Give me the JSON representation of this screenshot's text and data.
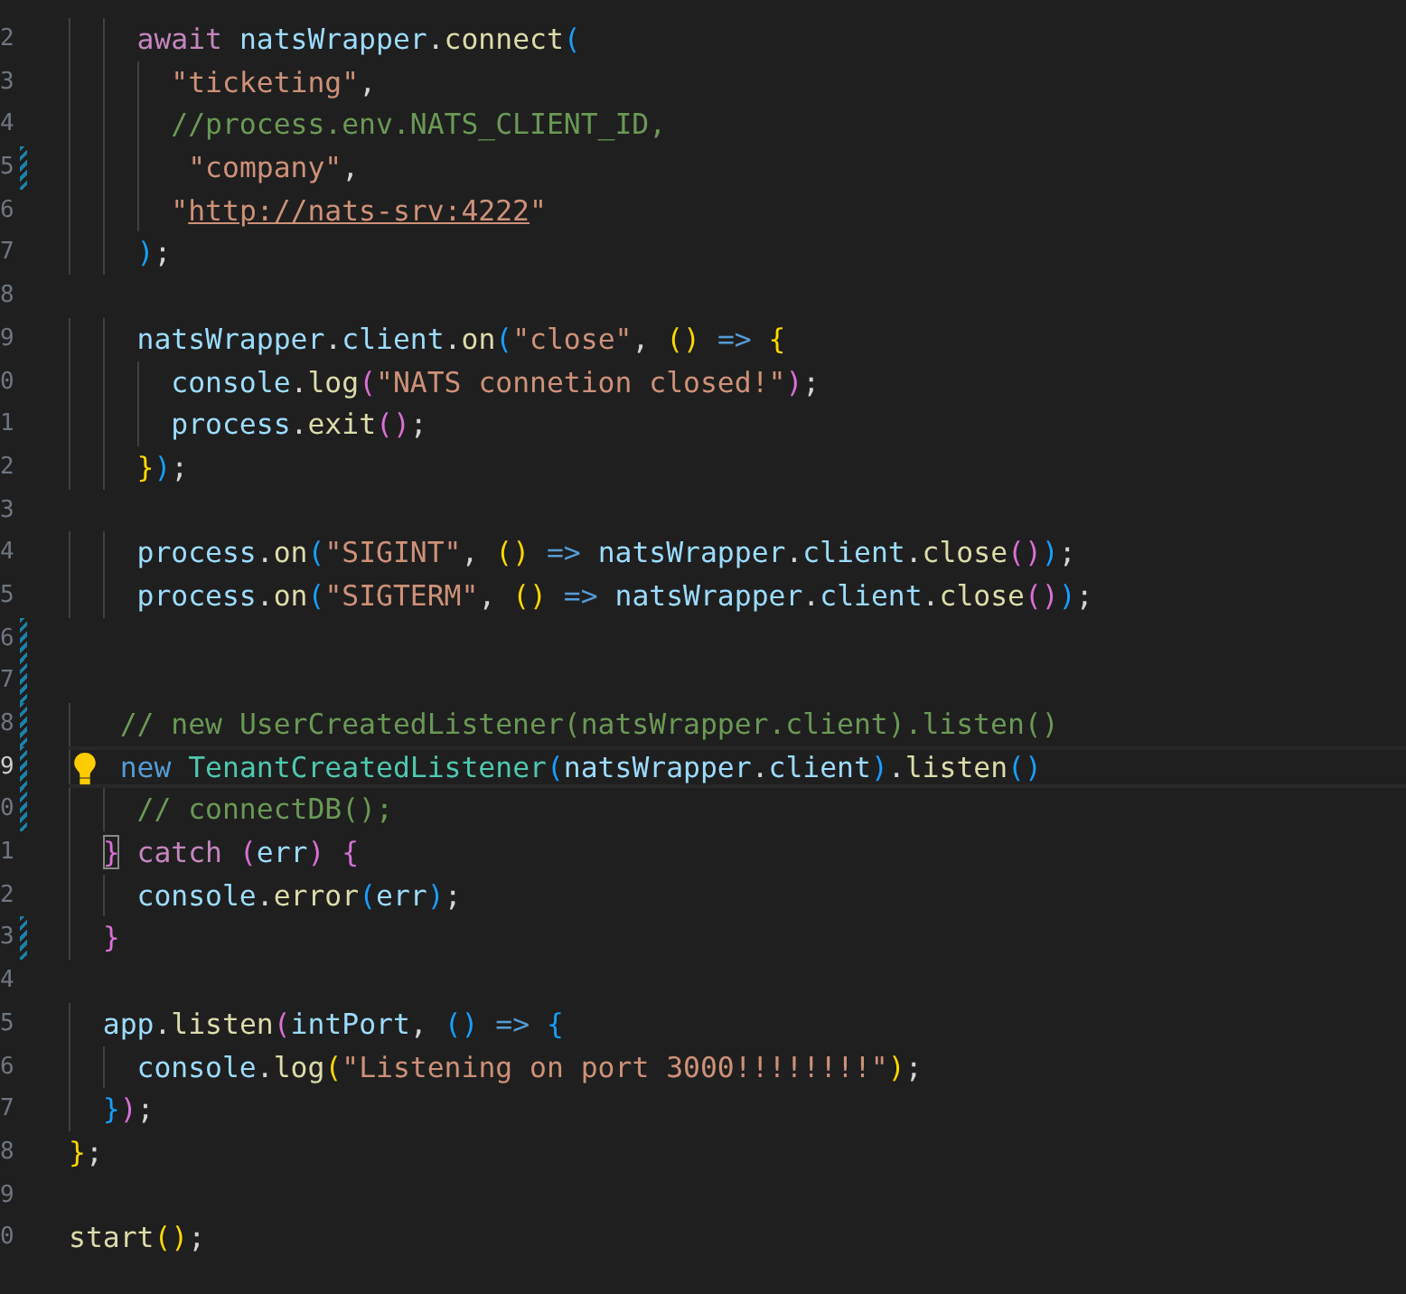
{
  "editor": {
    "lines": [
      {
        "number": "2",
        "tokens": [
          {
            "t": "    await",
            "kind": "keyword"
          },
          {
            "t": " natsWrapper",
            "kind": "variable"
          },
          {
            "t": ".",
            "kind": "plain"
          },
          {
            "t": "connect",
            "kind": "function"
          },
          {
            "t": "(",
            "kind": "bracket",
            "color": "#179fff"
          }
        ]
      },
      {
        "number": "3",
        "tokens": [
          {
            "t": "      \"ticketing\"",
            "kind": "string"
          },
          {
            "t": ",",
            "kind": "plain"
          }
        ]
      },
      {
        "number": "4",
        "tokens": [
          {
            "t": "      //process.env.NATS_CLIENT_ID,",
            "kind": "comment"
          }
        ]
      },
      {
        "number": "5",
        "modified": true,
        "tokens": [
          {
            "t": "       \"company\"",
            "kind": "string"
          },
          {
            "t": ",",
            "kind": "plain"
          }
        ]
      },
      {
        "number": "6",
        "tokens": [
          {
            "t": "      \"",
            "kind": "string"
          },
          {
            "t": "http://nats-srv:4222",
            "kind": "link"
          },
          {
            "t": "\"",
            "kind": "string"
          }
        ]
      },
      {
        "number": "7",
        "tokens": [
          {
            "t": "    )",
            "kind": "bracket",
            "color": "#179fff"
          },
          {
            "t": ";",
            "kind": "plain"
          }
        ]
      },
      {
        "number": "8"
      },
      {
        "number": "9",
        "tokens": [
          {
            "t": "    natsWrapper",
            "kind": "variable"
          },
          {
            "t": ".",
            "kind": "plain"
          },
          {
            "t": "client",
            "kind": "variable"
          },
          {
            "t": ".",
            "kind": "plain"
          },
          {
            "t": "on",
            "kind": "function"
          },
          {
            "t": "(",
            "kind": "bracket",
            "color": "#179fff"
          },
          {
            "t": "\"close\"",
            "kind": "string"
          },
          {
            "t": ", ",
            "kind": "plain"
          },
          {
            "t": "()",
            "kind": "bracket",
            "color": "#ffd700"
          },
          {
            "t": " => ",
            "kind": "storage"
          },
          {
            "t": "{",
            "kind": "bracket",
            "color": "#ffd700"
          }
        ]
      },
      {
        "number": "0",
        "tokens": [
          {
            "t": "      console",
            "kind": "variable"
          },
          {
            "t": ".",
            "kind": "plain"
          },
          {
            "t": "log",
            "kind": "function"
          },
          {
            "t": "(",
            "kind": "bracket",
            "color": "#da70d6"
          },
          {
            "t": "\"NATS connetion closed!\"",
            "kind": "string"
          },
          {
            "t": ")",
            "kind": "bracket",
            "color": "#da70d6"
          },
          {
            "t": ";",
            "kind": "plain"
          }
        ]
      },
      {
        "number": "1",
        "tokens": [
          {
            "t": "      process",
            "kind": "variable"
          },
          {
            "t": ".",
            "kind": "plain"
          },
          {
            "t": "exit",
            "kind": "function"
          },
          {
            "t": "()",
            "kind": "bracket",
            "color": "#da70d6"
          },
          {
            "t": ";",
            "kind": "plain"
          }
        ]
      },
      {
        "number": "2",
        "tokens": [
          {
            "t": "    }",
            "kind": "bracket",
            "color": "#ffd700"
          },
          {
            "t": ")",
            "kind": "bracket",
            "color": "#179fff"
          },
          {
            "t": ";",
            "kind": "plain"
          }
        ]
      },
      {
        "number": "3"
      },
      {
        "number": "4",
        "tokens": [
          {
            "t": "    process",
            "kind": "variable"
          },
          {
            "t": ".",
            "kind": "plain"
          },
          {
            "t": "on",
            "kind": "function"
          },
          {
            "t": "(",
            "kind": "bracket",
            "color": "#179fff"
          },
          {
            "t": "\"SIGINT\"",
            "kind": "string"
          },
          {
            "t": ", ",
            "kind": "plain"
          },
          {
            "t": "()",
            "kind": "bracket",
            "color": "#ffd700"
          },
          {
            "t": " => ",
            "kind": "storage"
          },
          {
            "t": "natsWrapper",
            "kind": "variable"
          },
          {
            "t": ".",
            "kind": "plain"
          },
          {
            "t": "client",
            "kind": "variable"
          },
          {
            "t": ".",
            "kind": "plain"
          },
          {
            "t": "close",
            "kind": "function"
          },
          {
            "t": "()",
            "kind": "bracket",
            "color": "#da70d6"
          },
          {
            "t": ")",
            "kind": "bracket",
            "color": "#179fff"
          },
          {
            "t": ";",
            "kind": "plain"
          }
        ]
      },
      {
        "number": "5",
        "tokens": [
          {
            "t": "    process",
            "kind": "variable"
          },
          {
            "t": ".",
            "kind": "plain"
          },
          {
            "t": "on",
            "kind": "function"
          },
          {
            "t": "(",
            "kind": "bracket",
            "color": "#179fff"
          },
          {
            "t": "\"SIGTERM\"",
            "kind": "string"
          },
          {
            "t": ", ",
            "kind": "plain"
          },
          {
            "t": "()",
            "kind": "bracket",
            "color": "#ffd700"
          },
          {
            "t": " => ",
            "kind": "storage"
          },
          {
            "t": "natsWrapper",
            "kind": "variable"
          },
          {
            "t": ".",
            "kind": "plain"
          },
          {
            "t": "client",
            "kind": "variable"
          },
          {
            "t": ".",
            "kind": "plain"
          },
          {
            "t": "close",
            "kind": "function"
          },
          {
            "t": "()",
            "kind": "bracket",
            "color": "#da70d6"
          },
          {
            "t": ")",
            "kind": "bracket",
            "color": "#179fff"
          },
          {
            "t": ";",
            "kind": "plain"
          }
        ]
      },
      {
        "number": "6",
        "modified": true
      },
      {
        "number": "7",
        "modified": true
      },
      {
        "number": "8",
        "modified": true,
        "tokens": [
          {
            "t": "   // new UserCreatedListener(natsWrapper.client).listen()",
            "kind": "comment"
          }
        ]
      },
      {
        "number": "9",
        "modified": true,
        "current": true,
        "lightbulb": true,
        "tokens": [
          {
            "t": "   new",
            "kind": "storage"
          },
          {
            "t": " TenantCreatedListener",
            "kind": "type"
          },
          {
            "t": "(",
            "kind": "bracket",
            "color": "#179fff"
          },
          {
            "t": "natsWrapper",
            "kind": "variable"
          },
          {
            "t": ".",
            "kind": "plain"
          },
          {
            "t": "client",
            "kind": "variable"
          },
          {
            "t": ")",
            "kind": "bracket",
            "color": "#179fff"
          },
          {
            "t": ".",
            "kind": "plain"
          },
          {
            "t": "listen",
            "kind": "function"
          },
          {
            "t": "()",
            "kind": "bracket",
            "color": "#179fff"
          }
        ]
      },
      {
        "number": "0",
        "modified": true,
        "tokens": [
          {
            "t": "    // connectDB();",
            "kind": "comment"
          }
        ]
      },
      {
        "number": "1",
        "tokens": [
          {
            "t": "  }",
            "kind": "bracket",
            "color": "#da70d6",
            "boxed": true
          },
          {
            "t": " catch",
            "kind": "keyword"
          },
          {
            "t": " (",
            "kind": "bracket",
            "color": "#da70d6"
          },
          {
            "t": "err",
            "kind": "variable"
          },
          {
            "t": ")",
            "kind": "bracket",
            "color": "#da70d6"
          },
          {
            "t": " {",
            "kind": "bracket",
            "color": "#da70d6"
          }
        ]
      },
      {
        "number": "2",
        "tokens": [
          {
            "t": "    console",
            "kind": "variable"
          },
          {
            "t": ".",
            "kind": "plain"
          },
          {
            "t": "error",
            "kind": "function"
          },
          {
            "t": "(",
            "kind": "bracket",
            "color": "#179fff"
          },
          {
            "t": "err",
            "kind": "variable"
          },
          {
            "t": ")",
            "kind": "bracket",
            "color": "#179fff"
          },
          {
            "t": ";",
            "kind": "plain"
          }
        ]
      },
      {
        "number": "3",
        "modified": true,
        "tokens": [
          {
            "t": "  }",
            "kind": "bracket",
            "color": "#da70d6"
          }
        ]
      },
      {
        "number": "4"
      },
      {
        "number": "5",
        "tokens": [
          {
            "t": "  app",
            "kind": "variable"
          },
          {
            "t": ".",
            "kind": "plain"
          },
          {
            "t": "listen",
            "kind": "function"
          },
          {
            "t": "(",
            "kind": "bracket",
            "color": "#da70d6"
          },
          {
            "t": "intPort",
            "kind": "variable"
          },
          {
            "t": ", ",
            "kind": "plain"
          },
          {
            "t": "()",
            "kind": "bracket",
            "color": "#179fff"
          },
          {
            "t": " => ",
            "kind": "storage"
          },
          {
            "t": "{",
            "kind": "bracket",
            "color": "#179fff"
          }
        ]
      },
      {
        "number": "6",
        "tokens": [
          {
            "t": "    console",
            "kind": "variable"
          },
          {
            "t": ".",
            "kind": "plain"
          },
          {
            "t": "log",
            "kind": "function"
          },
          {
            "t": "(",
            "kind": "bracket",
            "color": "#ffd700"
          },
          {
            "t": "\"Listening on port 3000!!!!!!!!\"",
            "kind": "string"
          },
          {
            "t": ")",
            "kind": "bracket",
            "color": "#ffd700"
          },
          {
            "t": ";",
            "kind": "plain"
          }
        ]
      },
      {
        "number": "7",
        "tokens": [
          {
            "t": "  }",
            "kind": "bracket",
            "color": "#179fff"
          },
          {
            "t": ")",
            "kind": "bracket",
            "color": "#da70d6"
          },
          {
            "t": ";",
            "kind": "plain"
          }
        ]
      },
      {
        "number": "8",
        "tokens": [
          {
            "t": "}",
            "kind": "bracket",
            "color": "#ffd700"
          },
          {
            "t": ";",
            "kind": "plain"
          }
        ]
      },
      {
        "number": "9"
      },
      {
        "number": "0",
        "tokens": [
          {
            "t": "start",
            "kind": "function"
          },
          {
            "t": "()",
            "kind": "bracket",
            "color": "#ffd700"
          },
          {
            "t": ";",
            "kind": "plain"
          }
        ]
      }
    ]
  }
}
